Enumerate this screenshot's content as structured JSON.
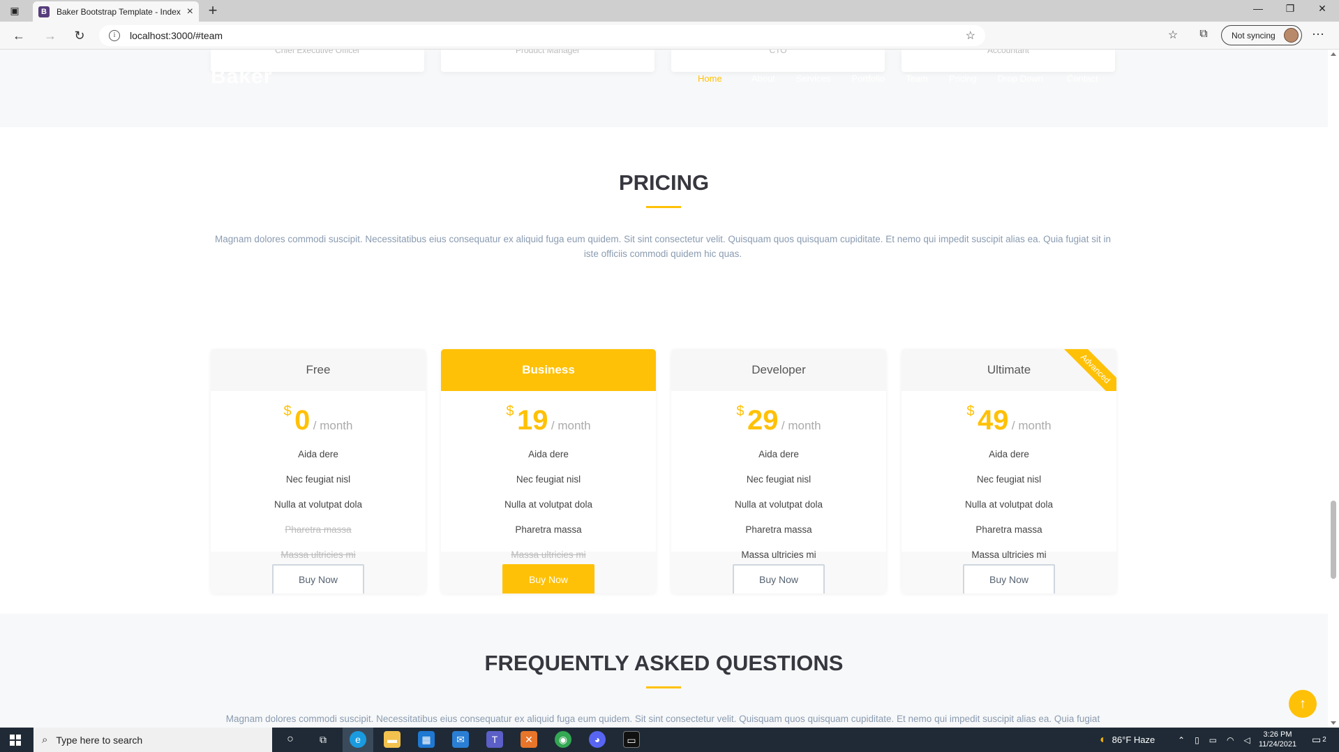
{
  "browser": {
    "tab_title": "Baker Bootstrap Template - Index",
    "tab_favicon": "B",
    "new_tab_symbol": "+",
    "close_tab_symbol": "×",
    "url": "localhost:3000/#team",
    "sync_label": "Not syncing"
  },
  "team": {
    "roles": [
      "Chief Executive Officer",
      "Product Manager",
      "CTO",
      "Accountant"
    ]
  },
  "site_header": {
    "logo": "Baker",
    "nav": [
      "Home",
      "About",
      "Services",
      "Portfolio",
      "Team",
      "Pricing",
      "Drop Down",
      "Contact"
    ],
    "active_nav": "Home"
  },
  "pricing": {
    "title": "PRICING",
    "description": "Magnam dolores commodi suscipit. Necessitatibus eius consequatur ex aliquid fuga eum quidem. Sit sint consectetur velit. Quisquam quos quisquam cupiditate. Et nemo qui impedit suscipit alias ea. Quia fugiat sit in iste officiis commodi quidem hic quas.",
    "currency": "$",
    "period": "/ month",
    "plans": [
      {
        "name": "Free",
        "price": "0",
        "button": "Buy Now",
        "features": [
          {
            "text": "Aida dere",
            "available": true
          },
          {
            "text": "Nec feugiat nisl",
            "available": true
          },
          {
            "text": "Nulla at volutpat dola",
            "available": true
          },
          {
            "text": "Pharetra massa",
            "available": false
          },
          {
            "text": "Massa ultricies mi",
            "available": false
          }
        ]
      },
      {
        "name": "Business",
        "price": "19",
        "button": "Buy Now",
        "featured": true,
        "features": [
          {
            "text": "Aida dere",
            "available": true
          },
          {
            "text": "Nec feugiat nisl",
            "available": true
          },
          {
            "text": "Nulla at volutpat dola",
            "available": true
          },
          {
            "text": "Pharetra massa",
            "available": true
          },
          {
            "text": "Massa ultricies mi",
            "available": false
          }
        ]
      },
      {
        "name": "Developer",
        "price": "29",
        "button": "Buy Now",
        "features": [
          {
            "text": "Aida dere",
            "available": true
          },
          {
            "text": "Nec feugiat nisl",
            "available": true
          },
          {
            "text": "Nulla at volutpat dola",
            "available": true
          },
          {
            "text": "Pharetra massa",
            "available": true
          },
          {
            "text": "Massa ultricies mi",
            "available": true
          }
        ]
      },
      {
        "name": "Ultimate",
        "price": "49",
        "button": "Buy Now",
        "ribbon": "Advanced",
        "features": [
          {
            "text": "Aida dere",
            "available": true
          },
          {
            "text": "Nec feugiat nisl",
            "available": true
          },
          {
            "text": "Nulla at volutpat dola",
            "available": true
          },
          {
            "text": "Pharetra massa",
            "available": true
          },
          {
            "text": "Massa ultricies mi",
            "available": true
          }
        ]
      }
    ]
  },
  "faq": {
    "title": "FREQUENTLY ASKED QUESTIONS",
    "description": "Magnam dolores commodi suscipit. Necessitatibus eius consequatur ex aliquid fuga eum quidem. Sit sint consectetur velit. Quisquam quos quisquam cupiditate. Et nemo qui impedit suscipit alias ea. Quia fugiat"
  },
  "scroll_top_symbol": "↑",
  "taskbar": {
    "search_placeholder": "Type here to search",
    "weather": "86°F  Haze",
    "time": "3:26 PM",
    "date": "11/24/2021",
    "notification_count": "2"
  },
  "colors": {
    "accent": "#ffc107",
    "heading": "#37373f",
    "muted_text": "#8a9bb0",
    "taskbar": "#1f2a36"
  }
}
